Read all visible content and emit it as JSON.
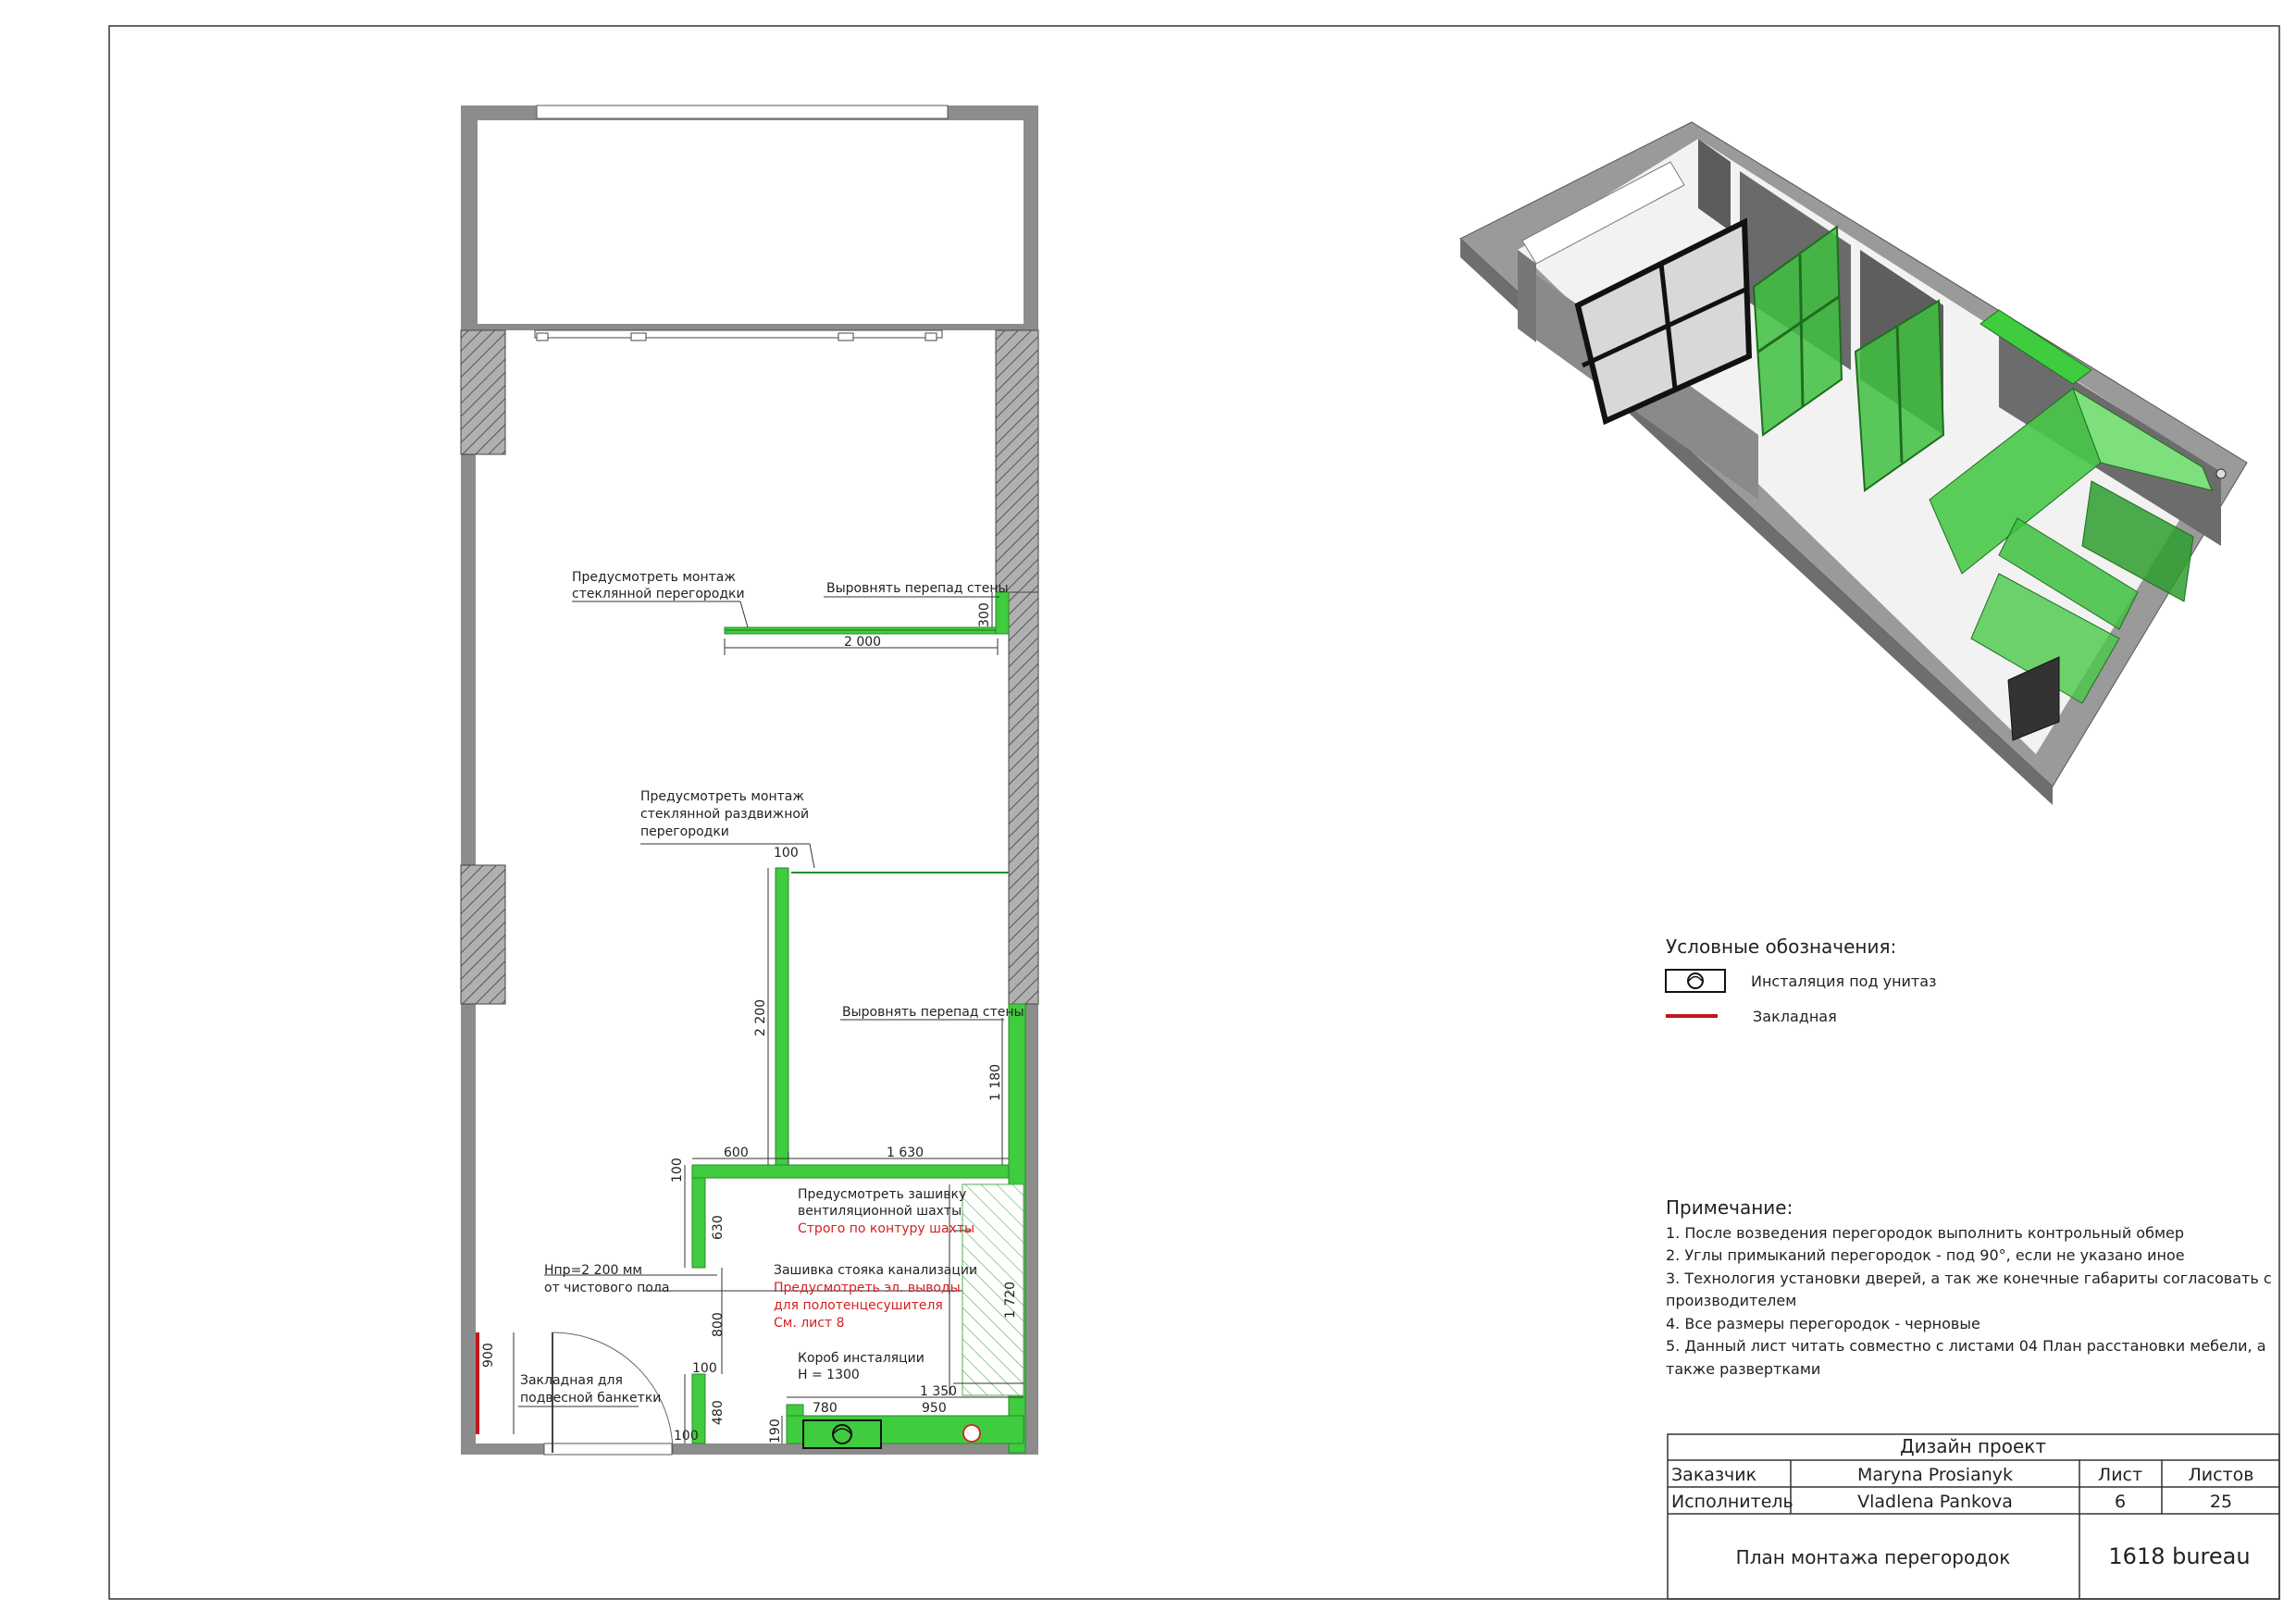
{
  "plan": {
    "notes": {
      "glass_partition_1": "Предусмотреть монтаж",
      "glass_partition_2": "стеклянной перегородки",
      "level_wall_top": "Выровнять перепад стены",
      "sliding_1": "Предусмотреть монтаж",
      "sliding_2": "стеклянной раздвижной",
      "sliding_3": "перегородки",
      "level_wall_mid": "Выровнять перепад стены",
      "vent_1": "Предусмотреть зашивку",
      "vent_2": "вентиляционной шахты",
      "vent_red": "Строго по контуру шахты",
      "sewer_1": "Зашивка стояка канализации",
      "sewer_red_1": "Предусмотреть эл. выводы",
      "sewer_red_2": "для полотенцесушителя",
      "sewer_red_3": "См. лист 8",
      "height_1": "Hпр=2 200 мм",
      "height_2": "от чистового пола",
      "box_1": "Короб инсталяции",
      "box_2": "H = 1300",
      "embed_1": "Закладная для",
      "embed_2": "подвесной банкетки"
    },
    "dims": {
      "d2000": "2 000",
      "d300": "300",
      "d100a": "100",
      "d2200": "2 200",
      "d1180": "1 180",
      "d600": "600",
      "d1630": "1 630",
      "d100b": "100",
      "d630": "630",
      "d800": "800",
      "d100c": "100",
      "d480": "480",
      "d100d": "100",
      "d190": "190",
      "d1720": "1 720",
      "d1350": "1 350",
      "d780": "780",
      "d950": "950",
      "d900": "900"
    }
  },
  "legend": {
    "title": "Условные обозначения:",
    "items": [
      {
        "icon": "toilet-installation-icon",
        "label": "Инсталяция под унитаз"
      },
      {
        "icon": "embedded-red-line-icon",
        "label": "Закладная"
      }
    ]
  },
  "notes": {
    "title": "Примечание:",
    "lines": [
      "1. После возведения перегородок выполнить контрольный обмер",
      "2. Углы примыканий перегородок - под 90°, если не указано иное",
      "3. Технология установки дверей, а так же конечные габариты согласовать с",
      "производителем",
      "4. Все размеры перегородок - черновые",
      "5. Данный лист читать совместно с листами 04 План расстановки мебели, а",
      "также развертками"
    ]
  },
  "title_block": {
    "header": "Дизайн проект",
    "client_label": "Заказчик",
    "client_name": "Maryna Prosianyk",
    "sheet_label": "Лист",
    "sheets_label": "Листов",
    "executor_label": "Исполнитель",
    "executor_name": "Vladlena Pankova",
    "sheet_no": "6",
    "sheets_total": "25",
    "drawing_title": "План монтажа перегородок",
    "brand": "1618 bureau"
  },
  "colors": {
    "partition": "#3fcc3f",
    "wall": "#8a8a8a",
    "embed": "#c0181c",
    "hatch": "#6a6a6a"
  }
}
